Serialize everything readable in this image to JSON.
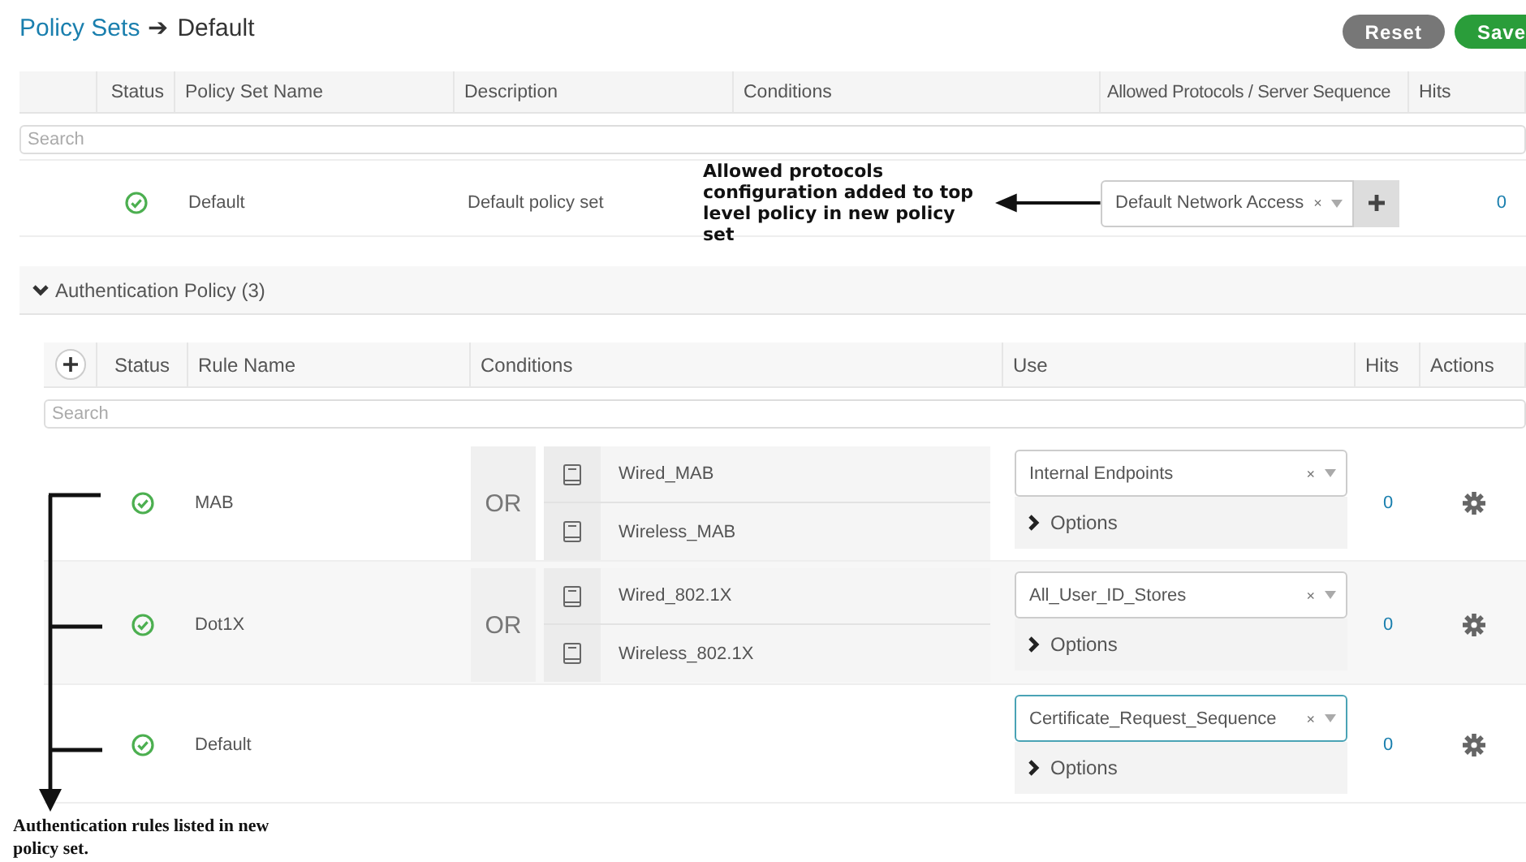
{
  "breadcrumb": {
    "link": "Policy Sets",
    "separator": "➔",
    "current": "Default"
  },
  "buttons": [
    {
      "label": "Reset",
      "kind": "reset"
    },
    {
      "label": "Save",
      "kind": "save"
    }
  ],
  "policy_sets": {
    "columns": [
      "Status",
      "Policy Set Name",
      "Description",
      "Conditions",
      "Allowed Protocols / Server Sequence",
      "Hits"
    ],
    "search": {
      "placeholder": "Search"
    },
    "rows": [
      {
        "enabled": true,
        "name": "Default",
        "description": "Default policy set",
        "protocols": "Default Network Access",
        "clear": "×",
        "hits": "0"
      }
    ]
  },
  "callouts": [
    {
      "text": "Allowed protocols configuration added to top level policy in new policy set"
    },
    {
      "text": "Authentication rules listed in new policy set."
    }
  ],
  "authentication_policy": {
    "title": "Authentication Policy (3)",
    "expanded": true,
    "columns": [
      "Status",
      "Rule Name",
      "Conditions",
      "Use",
      "Hits",
      "Actions"
    ],
    "search": {
      "placeholder": "Search"
    },
    "rules": [
      {
        "enabled": true,
        "name": "MAB",
        "operator": "OR",
        "conditions": [
          "Wired_MAB",
          "Wireless_MAB"
        ],
        "use": "Internal Endpoints",
        "clear": "×",
        "focused": false,
        "options": "Options",
        "hits": "0"
      },
      {
        "enabled": true,
        "name": "Dot1X",
        "operator": "OR",
        "conditions": [
          "Wired_802.1X",
          "Wireless_802.1X"
        ],
        "use": "All_User_ID_Stores",
        "clear": "×",
        "focused": false,
        "options": "Options",
        "hits": "0"
      },
      {
        "enabled": true,
        "name": "Default",
        "use": "Certificate_Request_Sequence",
        "clear": "×",
        "focused": true,
        "options": "Options",
        "hits": "0"
      }
    ]
  }
}
